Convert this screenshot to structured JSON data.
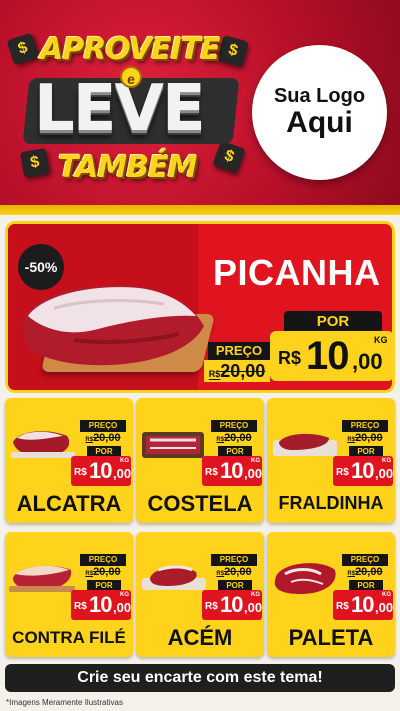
{
  "header": {
    "campaign_top": "APROVEITE",
    "campaign_connector": "e",
    "campaign_main": "LEVE",
    "campaign_bottom": "TAMBÉM",
    "dollar_symbol": "$",
    "logo_line1": "Sua Logo",
    "logo_line2": "Aqui"
  },
  "colors": {
    "brand_red": "#e0141f",
    "brand_yellow": "#ffd21c",
    "dark": "#151515"
  },
  "hero": {
    "discount": "-50%",
    "product": "PICANHA",
    "preco_label": "PREÇO",
    "old_currency": "R$",
    "old_price": "20,00",
    "por_label": "POR",
    "currency": "R$",
    "price_int": "10",
    "price_cents": ",00",
    "unit": "KG"
  },
  "products": [
    {
      "name": "ALCATRA",
      "preco_label": "PREÇO",
      "old_currency": "R$",
      "old_price": "20,00",
      "por_label": "POR",
      "currency": "R$",
      "price_int": "10",
      "price_cents": ",00",
      "unit": "KG"
    },
    {
      "name": "COSTELA",
      "preco_label": "PREÇO",
      "old_currency": "R$",
      "old_price": "20,00",
      "por_label": "POR",
      "currency": "R$",
      "price_int": "10",
      "price_cents": ",00",
      "unit": "KG"
    },
    {
      "name": "FRALDINHA",
      "preco_label": "PREÇO",
      "old_currency": "R$",
      "old_price": "20,00",
      "por_label": "POR",
      "currency": "R$",
      "price_int": "10",
      "price_cents": ",00",
      "unit": "KG"
    },
    {
      "name": "CONTRA FILÉ",
      "preco_label": "PREÇO",
      "old_currency": "R$",
      "old_price": "20,00",
      "por_label": "POR",
      "currency": "R$",
      "price_int": "10",
      "price_cents": ",00",
      "unit": "KG"
    },
    {
      "name": "ACÉM",
      "preco_label": "PREÇO",
      "old_currency": "R$",
      "old_price": "20,00",
      "por_label": "POR",
      "currency": "R$",
      "price_int": "10",
      "price_cents": ",00",
      "unit": "KG"
    },
    {
      "name": "PALETA",
      "preco_label": "PREÇO",
      "old_currency": "R$",
      "old_price": "20,00",
      "por_label": "POR",
      "currency": "R$",
      "price_int": "10",
      "price_cents": ",00",
      "unit": "KG"
    }
  ],
  "footer": {
    "cta": "Crie seu encarte com este tema!",
    "disclaimer": "*Imagens Meramente Ilustrativas"
  }
}
